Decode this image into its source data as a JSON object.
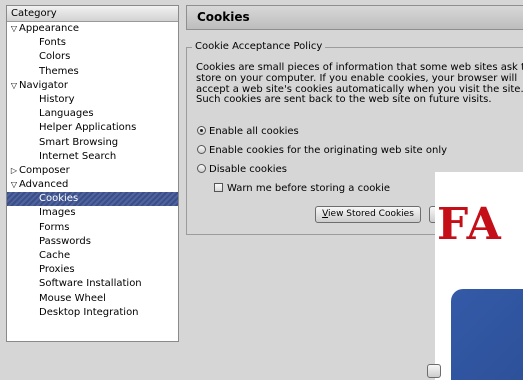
{
  "tree": {
    "header": "Category",
    "rows": [
      {
        "label": "Appearance",
        "level": 0,
        "twisty": "expanded"
      },
      {
        "label": "Fonts",
        "level": 1
      },
      {
        "label": "Colors",
        "level": 1
      },
      {
        "label": "Themes",
        "level": 1
      },
      {
        "label": "Navigator",
        "level": 0,
        "twisty": "expanded"
      },
      {
        "label": "History",
        "level": 1
      },
      {
        "label": "Languages",
        "level": 1
      },
      {
        "label": "Helper Applications",
        "level": 1
      },
      {
        "label": "Smart Browsing",
        "level": 1
      },
      {
        "label": "Internet Search",
        "level": 1
      },
      {
        "label": "Composer",
        "level": 0,
        "twisty": "collapsed"
      },
      {
        "label": "Advanced",
        "level": 0,
        "twisty": "expanded"
      },
      {
        "label": "Cookies",
        "level": 1,
        "selected": true
      },
      {
        "label": "Images",
        "level": 1
      },
      {
        "label": "Forms",
        "level": 1
      },
      {
        "label": "Passwords",
        "level": 1
      },
      {
        "label": "Cache",
        "level": 1
      },
      {
        "label": "Proxies",
        "level": 1
      },
      {
        "label": "Software Installation",
        "level": 1
      },
      {
        "label": "Mouse Wheel",
        "level": 1
      },
      {
        "label": "Desktop Integration",
        "level": 1
      }
    ]
  },
  "panel": {
    "title": "Cookies",
    "group_legend": "Cookie Acceptance Policy",
    "description": "Cookies are small pieces of information that some web sites ask to store on your computer. If you enable cookies, your browser will accept a web site's cookies automatically when you visit the site. Such cookies are sent back to the web site on future visits.",
    "options": [
      {
        "label": "Enable all cookies",
        "checked": true
      },
      {
        "label": "Enable cookies for the originating web site only",
        "checked": false
      },
      {
        "label": "Disable cookies",
        "checked": false
      }
    ],
    "warn_checkbox": {
      "label": "Warn me before storing a cookie",
      "checked": false
    },
    "view_stored_cookies_button": {
      "before": "",
      "accesskey": "V",
      "after": "iew Stored Cookies"
    }
  },
  "overlay": {
    "text": "FA"
  },
  "colors": {
    "selection": "#3b4f86",
    "overlay_red": "#c40f18",
    "overlay_blue": "#345aa8"
  }
}
